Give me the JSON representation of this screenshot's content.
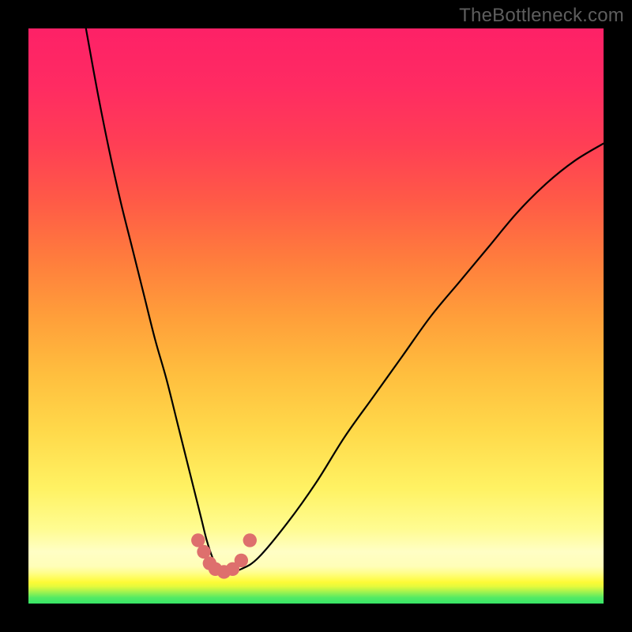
{
  "watermark": "TheBottleneck.com",
  "chart_data": {
    "type": "line",
    "title": "",
    "xlabel": "",
    "ylabel": "",
    "xlim": [
      0,
      100
    ],
    "ylim": [
      0,
      100
    ],
    "grid": false,
    "legend": false,
    "annotations": [],
    "series": [
      {
        "name": "curve",
        "x": [
          10,
          12,
          14,
          16,
          18,
          20,
          22,
          24,
          26,
          28,
          30,
          31,
          32,
          33,
          34,
          35,
          37,
          40,
          45,
          50,
          55,
          60,
          65,
          70,
          75,
          80,
          85,
          90,
          95,
          100
        ],
        "values": [
          100,
          89,
          79,
          70,
          62,
          54,
          46,
          39,
          31,
          23,
          15,
          11,
          8,
          6,
          5.5,
          5.5,
          6,
          8,
          14,
          21,
          29,
          36,
          43,
          50,
          56,
          62,
          68,
          73,
          77,
          80
        ]
      }
    ],
    "markers": [
      {
        "name": "bottom-dots",
        "color": "#de6f6d",
        "points": [
          {
            "x": 29.5,
            "y": 11
          },
          {
            "x": 30.5,
            "y": 9
          },
          {
            "x": 31.5,
            "y": 7
          },
          {
            "x": 32.5,
            "y": 6
          },
          {
            "x": 34.0,
            "y": 5.5
          },
          {
            "x": 35.5,
            "y": 6
          },
          {
            "x": 37.0,
            "y": 7.5
          },
          {
            "x": 38.5,
            "y": 11
          }
        ]
      }
    ],
    "background_gradient": {
      "direction": "vertical",
      "stops": [
        {
          "pos": 0.0,
          "color": "#37e666"
        },
        {
          "pos": 0.05,
          "color": "#e6fa3c"
        },
        {
          "pos": 0.09,
          "color": "#fffec5"
        },
        {
          "pos": 0.5,
          "color": "#ff9e3a"
        },
        {
          "pos": 1.0,
          "color": "#fd2167"
        }
      ]
    }
  }
}
